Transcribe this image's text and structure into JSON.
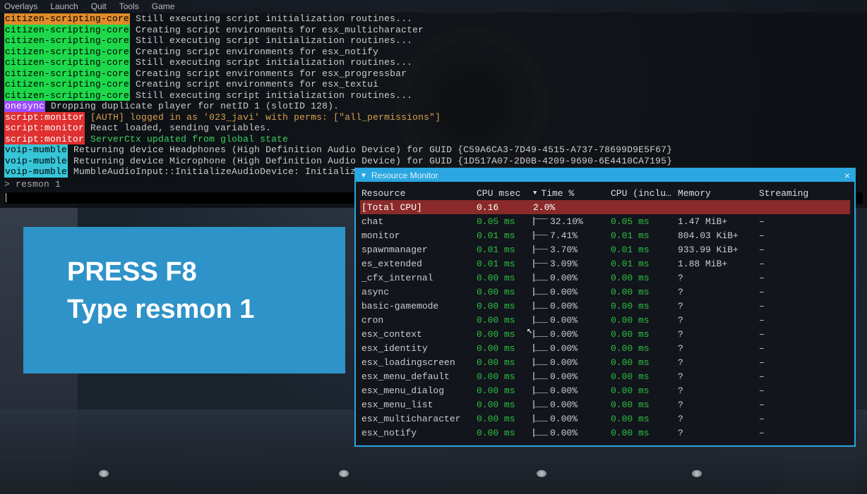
{
  "menubar": [
    "Overlays",
    "Launch",
    "Quit",
    "Tools",
    "Game"
  ],
  "console": {
    "lines": [
      {
        "tag": "citizen-scripting-core",
        "tagClass": "tag-orange",
        "msg": "Still executing script initialization routines..."
      },
      {
        "tag": "citizen-scripting-core",
        "tagClass": "tag-green",
        "msg": "Creating script environments for esx_multicharacter"
      },
      {
        "tag": "citizen-scripting-core",
        "tagClass": "tag-green",
        "msg": "Still executing script initialization routines..."
      },
      {
        "tag": "citizen-scripting-core",
        "tagClass": "tag-green",
        "msg": "Creating script environments for esx_notify"
      },
      {
        "tag": "citizen-scripting-core",
        "tagClass": "tag-green",
        "msg": "Still executing script initialization routines..."
      },
      {
        "tag": "citizen-scripting-core",
        "tagClass": "tag-green",
        "msg": "Creating script environments for esx_progressbar"
      },
      {
        "tag": "citizen-scripting-core",
        "tagClass": "tag-green",
        "msg": "Creating script environments for esx_textui"
      },
      {
        "tag": "citizen-scripting-core",
        "tagClass": "tag-green",
        "msg": "Still executing script initialization routines..."
      },
      {
        "tag": "onesync",
        "tagClass": "tag-purple",
        "msg": "Dropping duplicate player for netID 1 (slotID 128)."
      },
      {
        "tag": "script:monitor",
        "tagClass": "tag-red",
        "msg": "[AUTH] logged in as '023_javi' with perms: [\"all_permissions\"]",
        "msgClass": "msg-orange"
      },
      {
        "tag": "script:monitor",
        "tagClass": "tag-red",
        "msg": "React loaded, sending variables."
      },
      {
        "tag": "script:monitor",
        "tagClass": "tag-red",
        "msg": "ServerCtx updated from global state",
        "msgClass": "msg-green"
      },
      {
        "tag": "voip-mumble",
        "tagClass": "tag-cyan",
        "msg": "Returning device Headphones (High Definition Audio Device) for GUID {C59A6CA3-7D49-4515-A737-78699D9E5F67}"
      },
      {
        "tag": "voip-mumble",
        "tagClass": "tag-cyan",
        "msg": "Returning device Microphone (High Definition Audio Device) for GUID {1D517A07-2D0B-4209-9690-6E4410CA7195}"
      },
      {
        "tag": "voip-mumble",
        "tagClass": "tag-cyan",
        "msg": "MumbleAudioInput::InitializeAudioDevice: Initialized au"
      }
    ],
    "prompt": "> resmon 1"
  },
  "instruction": {
    "line1": "PRESS F8",
    "line2": "Type resmon 1"
  },
  "resmon": {
    "title": "Resource Monitor",
    "headers": {
      "resource": "Resource",
      "cpu": "CPU msec",
      "time": "Time %",
      "incl": "CPU (inclu…",
      "mem": "Memory",
      "stream": "Streaming"
    },
    "total": {
      "name": "[Total CPU]",
      "cpu": "0.16",
      "time": "2.0%"
    },
    "rows": [
      {
        "name": "chat",
        "cpu": "0.05 ms",
        "time": "32.10%",
        "spark": "spark-high",
        "incl": "0.05 ms",
        "mem": "1.47 MiB+",
        "stream": "–"
      },
      {
        "name": "monitor",
        "cpu": "0.01 ms",
        "time": "7.41%",
        "spark": "spark-mid",
        "incl": "0.01 ms",
        "mem": "804.03 KiB+",
        "stream": "–"
      },
      {
        "name": "spawnmanager",
        "cpu": "0.01 ms",
        "time": "3.70%",
        "spark": "spark-mid",
        "incl": "0.01 ms",
        "mem": "933.99 KiB+",
        "stream": "–"
      },
      {
        "name": "es_extended",
        "cpu": "0.01 ms",
        "time": "3.09%",
        "spark": "spark-mid",
        "incl": "0.01 ms",
        "mem": "1.88 MiB+",
        "stream": "–"
      },
      {
        "name": "_cfx_internal",
        "cpu": "0.00 ms",
        "time": "0.00%",
        "spark": "spark-low",
        "incl": "0.00 ms",
        "mem": "?",
        "stream": "–"
      },
      {
        "name": "async",
        "cpu": "0.00 ms",
        "time": "0.00%",
        "spark": "spark-low",
        "incl": "0.00 ms",
        "mem": "?",
        "stream": "–"
      },
      {
        "name": "basic-gamemode",
        "cpu": "0.00 ms",
        "time": "0.00%",
        "spark": "spark-low",
        "incl": "0.00 ms",
        "mem": "?",
        "stream": "–"
      },
      {
        "name": "cron",
        "cpu": "0.00 ms",
        "time": "0.00%",
        "spark": "spark-low",
        "incl": "0.00 ms",
        "mem": "?",
        "stream": "–"
      },
      {
        "name": "esx_context",
        "cpu": "0.00 ms",
        "time": "0.00%",
        "spark": "spark-low",
        "incl": "0.00 ms",
        "mem": "?",
        "stream": "–"
      },
      {
        "name": "esx_identity",
        "cpu": "0.00 ms",
        "time": "0.00%",
        "spark": "spark-low",
        "incl": "0.00 ms",
        "mem": "?",
        "stream": "–"
      },
      {
        "name": "esx_loadingscreen",
        "cpu": "0.00 ms",
        "time": "0.00%",
        "spark": "spark-low",
        "incl": "0.00 ms",
        "mem": "?",
        "stream": "–"
      },
      {
        "name": "esx_menu_default",
        "cpu": "0.00 ms",
        "time": "0.00%",
        "spark": "spark-low",
        "incl": "0.00 ms",
        "mem": "?",
        "stream": "–"
      },
      {
        "name": "esx_menu_dialog",
        "cpu": "0.00 ms",
        "time": "0.00%",
        "spark": "spark-low",
        "incl": "0.00 ms",
        "mem": "?",
        "stream": "–"
      },
      {
        "name": "esx_menu_list",
        "cpu": "0.00 ms",
        "time": "0.00%",
        "spark": "spark-low",
        "incl": "0.00 ms",
        "mem": "?",
        "stream": "–"
      },
      {
        "name": "esx_multicharacter",
        "cpu": "0.00 ms",
        "time": "0.00%",
        "spark": "spark-low",
        "incl": "0.00 ms",
        "mem": "?",
        "stream": "–"
      },
      {
        "name": "esx_notify",
        "cpu": "0.00 ms",
        "time": "0.00%",
        "spark": "spark-low",
        "incl": "0.00 ms",
        "mem": "?",
        "stream": "–"
      }
    ]
  }
}
